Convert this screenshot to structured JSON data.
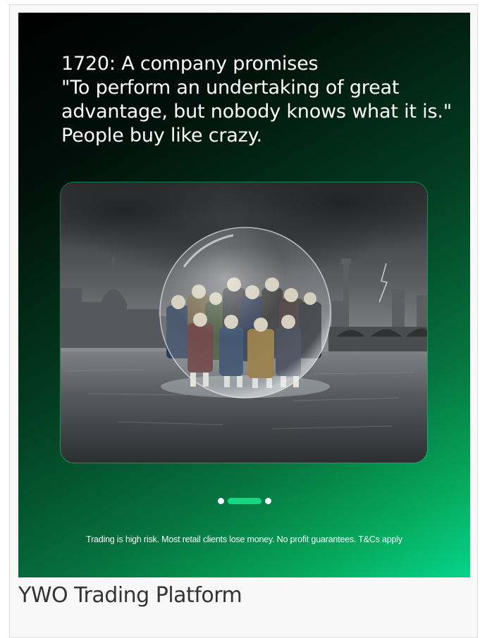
{
  "ad": {
    "headline_lines": [
      "1720: A company promises",
      "\"To perform an undertaking of great",
      "advantage, but nobody knows what it is.\"",
      "People buy like crazy."
    ],
    "carousel": {
      "slide_count": 3,
      "active_index": 1
    },
    "disclaimer": "Trading is high risk. Most retail clients lose money. No profit guarantees. T&Cs apply",
    "hero_image": {
      "icon": "bubble-men-river-image"
    }
  },
  "caption": "YWO Trading Platform",
  "colors": {
    "accent": "#12d883",
    "banner_dark": "#000000",
    "banner_light": "#05d58a"
  }
}
